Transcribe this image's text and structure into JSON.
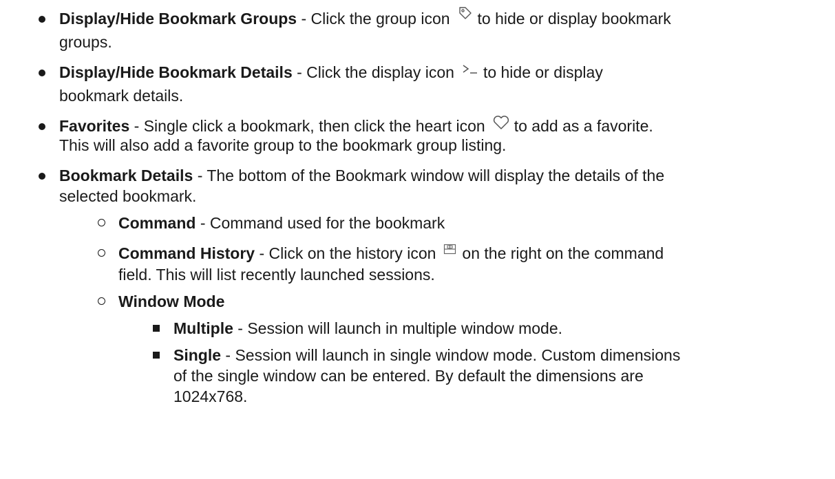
{
  "items": [
    {
      "title": "Display/Hide Bookmark Groups",
      "before_icon": " - Click the group icon",
      "icon": "tag-icon",
      "after_icon": "to hide or display bookmark",
      "continuation": "groups."
    },
    {
      "title": "Display/Hide Bookmark Details",
      "before_icon": " - Click the display icon",
      "icon": "terminal-prompt-icon",
      "after_icon": "to hide or display",
      "continuation": "bookmark details."
    },
    {
      "title": "Favorites",
      "before_icon": " - Single click a bookmark, then click the heart icon",
      "icon": "heart-icon",
      "after_icon": "to add as a favorite.",
      "continuation": "This will also add a favorite group to the bookmark group listing."
    },
    {
      "title": "Bookmark Details",
      "text": " - The bottom of the Bookmark window will display the details of the",
      "continuation": "selected bookmark.",
      "subitems": [
        {
          "title": "Command",
          "text": " - Command used for the bookmark"
        },
        {
          "title": "Command History",
          "before_icon": " - Click on the history icon",
          "icon": "history-window-icon",
          "after_icon": "on the right on the command",
          "continuation": "field.  This will list recently launched sessions."
        },
        {
          "title": "Window Mode",
          "subitems": [
            {
              "title": "Multiple",
              "text": " - Session will launch in multiple window mode."
            },
            {
              "title": "Single",
              "text": " - Session will launch in single window mode.  Custom dimensions",
              "continuation_1": "of the single window can be entered. By default the dimensions are",
              "continuation_2": "1024x768."
            }
          ]
        }
      ]
    }
  ]
}
